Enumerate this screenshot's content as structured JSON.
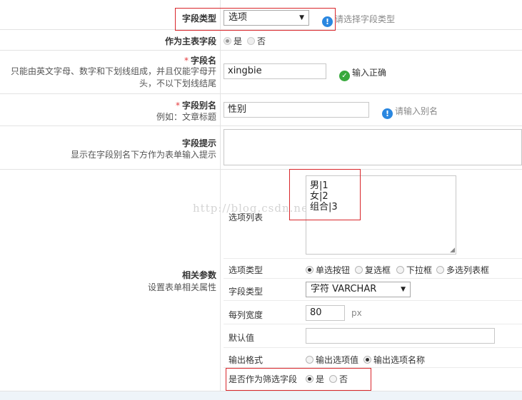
{
  "field_type": {
    "label": "字段类型",
    "value": "选项",
    "hint": "请选择字段类型"
  },
  "primary_field": {
    "label": "作为主表字段",
    "options": [
      "是",
      "否"
    ],
    "selected": 0
  },
  "field_name": {
    "required": "*",
    "label": "字段名",
    "desc": "只能由英文字母、数字和下划线组成，并且仅能字母开头，不以下划线结尾",
    "value": "xingbie",
    "status": "输入正确"
  },
  "field_alias": {
    "required": "*",
    "label": "字段别名",
    "desc": "例如：文章标题",
    "value": "性别",
    "hint": "请输入别名"
  },
  "field_tip": {
    "label": "字段提示",
    "desc": "显示在字段别名下方作为表单输入提示",
    "value": ""
  },
  "related": {
    "label": "相关参数",
    "desc": "设置表单相关属性",
    "option_list": {
      "label": "选项列表",
      "lines": [
        "男|1",
        "女|2",
        "组合|3"
      ]
    },
    "option_type": {
      "label": "选项类型",
      "options": [
        "单选按钮",
        "复选框",
        "下拉框",
        "多选列表框"
      ],
      "selected": 0
    },
    "field_type": {
      "label": "字段类型",
      "value": "字符 VARCHAR"
    },
    "column_width": {
      "label": "每列宽度",
      "value": "80",
      "unit": "px"
    },
    "default_value": {
      "label": "默认值",
      "value": ""
    },
    "output_format": {
      "label": "输出格式",
      "options": [
        "输出选项值",
        "输出选项名称"
      ],
      "selected": 1
    },
    "filter_field": {
      "label": "是否作为筛选字段",
      "options": [
        "是",
        "否"
      ],
      "selected": 0
    }
  },
  "watermark": "http://blog.csdn.net/",
  "colors": {
    "accent_red": "#d9262b",
    "info_blue": "#2a87e0",
    "ok_green": "#38a93c"
  }
}
